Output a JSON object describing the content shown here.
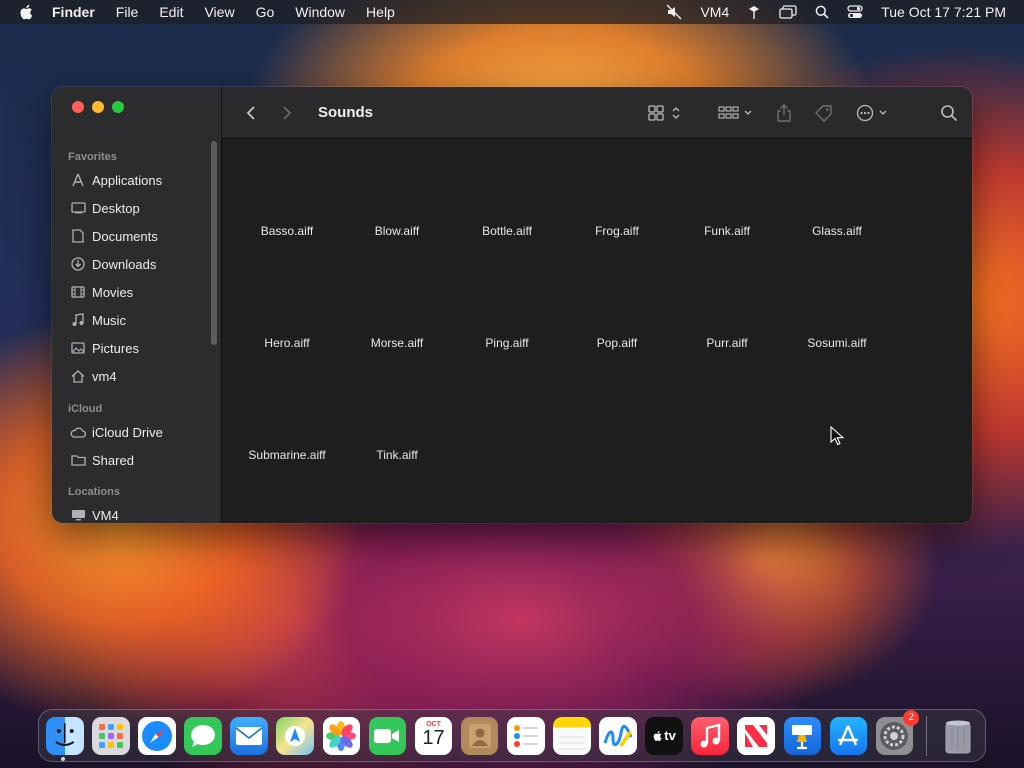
{
  "menubar": {
    "app_name": "Finder",
    "menus": [
      "File",
      "Edit",
      "View",
      "Go",
      "Window",
      "Help"
    ],
    "user_label": "VM4",
    "clock": "Tue Oct 17  7:21 PM"
  },
  "window": {
    "title": "Sounds",
    "sidebar": {
      "favorites_header": "Favorites",
      "favorites": [
        {
          "label": "Applications",
          "icon": "applications-icon"
        },
        {
          "label": "Desktop",
          "icon": "desktop-icon"
        },
        {
          "label": "Documents",
          "icon": "documents-icon"
        },
        {
          "label": "Downloads",
          "icon": "downloads-icon"
        },
        {
          "label": "Movies",
          "icon": "movies-icon"
        },
        {
          "label": "Music",
          "icon": "music-icon"
        },
        {
          "label": "Pictures",
          "icon": "pictures-icon"
        },
        {
          "label": "vm4",
          "icon": "home-icon"
        }
      ],
      "icloud_header": "iCloud",
      "icloud": [
        {
          "label": "iCloud Drive",
          "icon": "cloud-icon"
        },
        {
          "label": "Shared",
          "icon": "shared-folder-icon"
        }
      ],
      "locations_header": "Locations",
      "locations": [
        {
          "label": "VM4",
          "icon": "computer-icon"
        }
      ]
    },
    "files": [
      "Basso.aiff",
      "Blow.aiff",
      "Bottle.aiff",
      "Frog.aiff",
      "Funk.aiff",
      "Glass.aiff",
      "Hero.aiff",
      "Morse.aiff",
      "Ping.aiff",
      "Pop.aiff",
      "Purr.aiff",
      "Sosumi.aiff",
      "Submarine.aiff",
      "Tink.aiff"
    ]
  },
  "dock": {
    "calendar_month": "OCT",
    "calendar_day": "17",
    "tv_label": "tv",
    "settings_badge": "2",
    "apps": [
      "Finder",
      "Launchpad",
      "Safari",
      "Messages",
      "Mail",
      "Maps",
      "Photos",
      "FaceTime",
      "Calendar",
      "Contacts",
      "Reminders",
      "Notes",
      "Freeform",
      "TV",
      "Music",
      "News",
      "Keynote",
      "App Store",
      "System Settings"
    ]
  }
}
